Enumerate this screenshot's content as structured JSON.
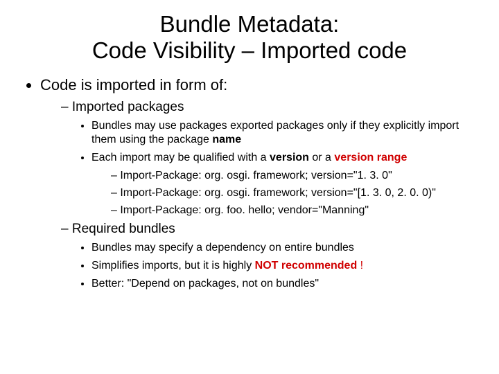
{
  "title_line1": "Bundle Metadata:",
  "title_line2": "Code Visibility – Imported code",
  "l1_1": "Code is imported in form of:",
  "l2_1": "Imported packages",
  "l3_1a": "Bundles may use packages exported packages only if they explicitly import them using the package ",
  "l3_1b": "name",
  "l3_2a": "Each import may be qualified with a ",
  "l3_2b": "version",
  "l3_2c": " or a ",
  "l3_2d": "version range",
  "l4_1": "Import-Package: org. osgi. framework; version=\"1. 3. 0\"",
  "l4_2": "Import-Package: org. osgi. framework; version=\"[1. 3. 0, 2. 0. 0)\"",
  "l4_3": "Import-Package: org. foo. hello; vendor=\"Manning\"",
  "l2_2": "Required bundles",
  "l3_3": "Bundles may specify a dependency on entire bundles",
  "l3_4a": "Simplifies imports, but it is highly ",
  "l3_4b": "NOT recommended ",
  "l3_4c": "!",
  "l3_5": " Better: \"Depend on packages, not on bundles\""
}
